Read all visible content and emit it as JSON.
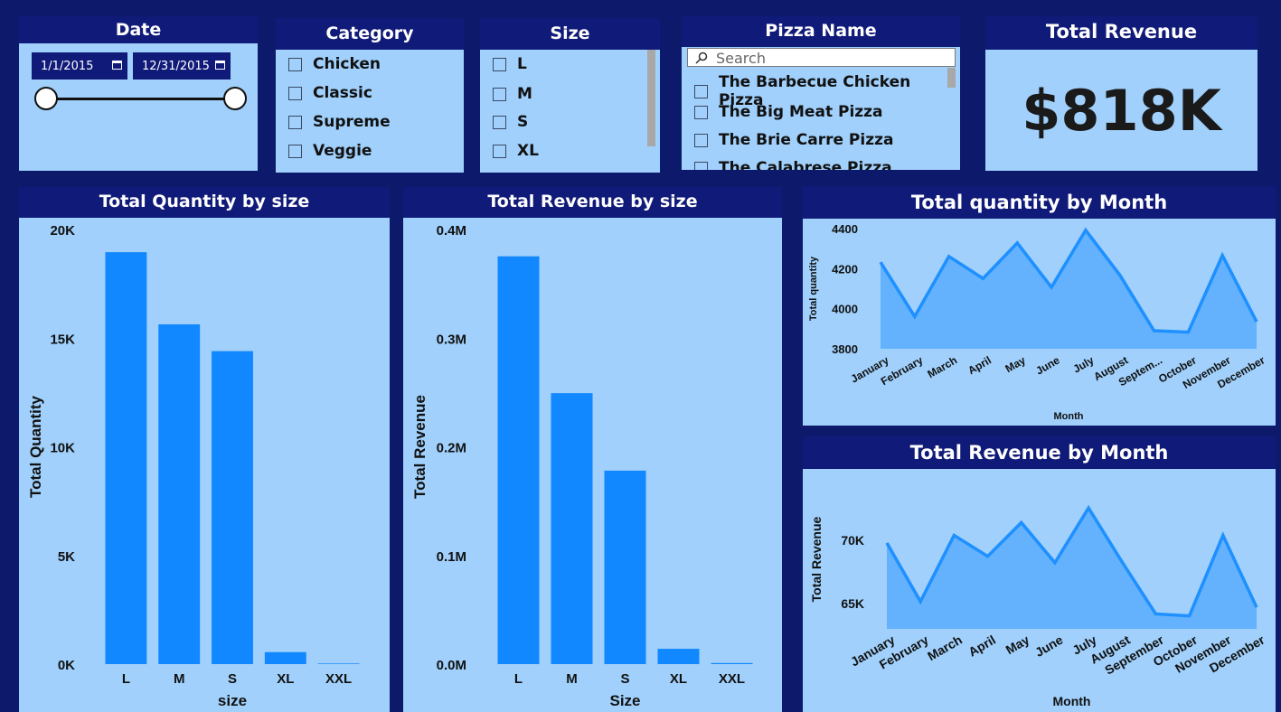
{
  "date_slicer": {
    "title": "Date",
    "start": "1/1/2015",
    "end": "12/31/2015"
  },
  "category_slicer": {
    "title": "Category",
    "items": [
      "Chicken",
      "Classic",
      "Supreme",
      "Veggie"
    ]
  },
  "size_slicer": {
    "title": "Size",
    "items": [
      "L",
      "M",
      "S",
      "XL"
    ]
  },
  "pizza_slicer": {
    "title": "Pizza Name",
    "search_placeholder": "Search",
    "items": [
      "The Barbecue Chicken Pizza",
      "The Big Meat Pizza",
      "The Brie Carre Pizza",
      "The Calabrese Pizza"
    ]
  },
  "kpi": {
    "title": "Total Revenue",
    "value": "$818K"
  },
  "colors": {
    "background": "#0d1a6b",
    "header": "#101a78",
    "panel": "#a0d0fb",
    "bar": "#1188ff",
    "line": "#1e90ff",
    "area": "#64b2fd"
  },
  "chart_data": [
    {
      "type": "bar",
      "title": "Total Quantity by size",
      "xlabel": "size",
      "ylabel": "Total Quantity",
      "categories": [
        "L",
        "M",
        "S",
        "XL",
        "XXL"
      ],
      "values": [
        18956,
        15635,
        14403,
        552,
        28
      ],
      "ylim": [
        0,
        20000
      ],
      "yticks": [
        "0K",
        "5K",
        "10K",
        "15K",
        "20K"
      ]
    },
    {
      "type": "bar",
      "title": "Total Revenue by size",
      "xlabel": "Size",
      "ylabel": "Total Revenue",
      "categories": [
        "L",
        "M",
        "S",
        "XL",
        "XXL"
      ],
      "values": [
        375319,
        249382,
        178076,
        14076,
        1007
      ],
      "ylim": [
        0,
        400000
      ],
      "yticks": [
        "0.0M",
        "0.1M",
        "0.2M",
        "0.3M",
        "0.4M"
      ]
    },
    {
      "type": "area",
      "title": "Total quantity by Month",
      "xlabel": "Month",
      "ylabel": "Total quantity",
      "categories": [
        "January",
        "February",
        "March",
        "April",
        "May",
        "June",
        "July",
        "August",
        "Septem...",
        "October",
        "November",
        "December"
      ],
      "values": [
        4232,
        3961,
        4261,
        4151,
        4328,
        4107,
        4392,
        4168,
        3890,
        3883,
        4266,
        3935
      ],
      "ylim": [
        3800,
        4400
      ],
      "yticks": [
        "3800",
        "4000",
        "4200",
        "4400"
      ]
    },
    {
      "type": "area",
      "title": "Total Revenue by Month",
      "xlabel": "Month",
      "ylabel": "Total Revenue",
      "categories": [
        "January",
        "February",
        "March",
        "April",
        "May",
        "June",
        "July",
        "August",
        "September",
        "October",
        "November",
        "December"
      ],
      "values": [
        69793,
        65160,
        70397,
        68737,
        71403,
        68230,
        72558,
        68278,
        64180,
        64028,
        70395,
        64702
      ],
      "ylim": [
        63000,
        74000
      ],
      "yticks": [
        "65K",
        "70K"
      ]
    }
  ]
}
